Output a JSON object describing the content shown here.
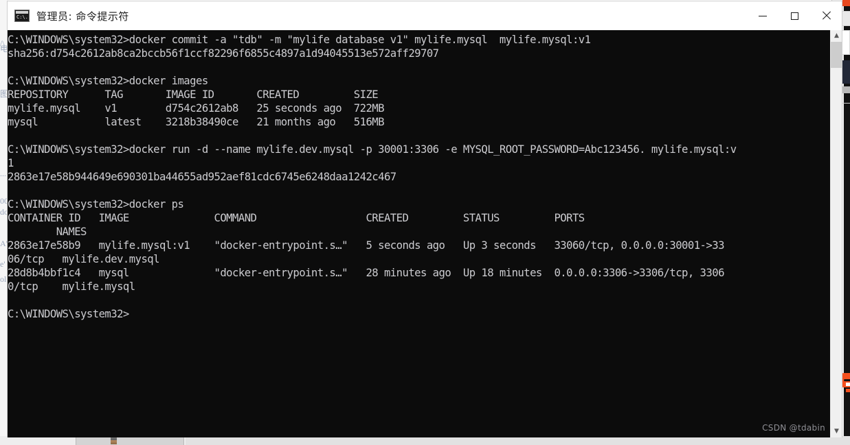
{
  "window": {
    "title": "管理员: 命令提示符",
    "icon": "cmd-icon",
    "icon_text": "C:\\.",
    "controls": {
      "minimize": "minimize-button",
      "maximize": "maximize-button",
      "close": "close-button"
    }
  },
  "console": {
    "prompt": "C:\\WINDOWS\\system32>",
    "lines": [
      "C:\\WINDOWS\\system32>docker commit -a \"tdb\" -m \"mylife database v1\" mylife.mysql  mylife.mysql:v1",
      "sha256:d754c2612ab8ca2bccb56f1ccf82296f6855c4897a1d94045513e572aff29707",
      "",
      "C:\\WINDOWS\\system32>docker images",
      "REPOSITORY      TAG       IMAGE ID       CREATED         SIZE",
      "mylife.mysql    v1        d754c2612ab8   25 seconds ago  722MB",
      "mysql           latest    3218b38490ce   21 months ago   516MB",
      "",
      "C:\\WINDOWS\\system32>docker run -d --name mylife.dev.mysql -p 30001:3306 -e MYSQL_ROOT_PASSWORD=Abc123456. mylife.mysql:v",
      "1",
      "2863e17e58b944649e690301ba44655ad952aef81cdc6745e6248daa1242c467",
      "",
      "C:\\WINDOWS\\system32>docker ps",
      "CONTAINER ID   IMAGE              COMMAND                  CREATED         STATUS         PORTS",
      "        NAMES",
      "2863e17e58b9   mylife.mysql:v1    \"docker-entrypoint.s…\"   5 seconds ago   Up 3 seconds   33060/tcp, 0.0.0.0:30001->33",
      "06/tcp   mylife.dev.mysql",
      "28d8b4bbf1c4   mysql              \"docker-entrypoint.s…\"   28 minutes ago  Up 18 minutes  0.0.0.0:3306->3306/tcp, 3306",
      "0/tcp    mylife.mysql",
      "",
      "C:\\WINDOWS\\system32>"
    ],
    "scrollbar": {
      "up_arrow": "▲",
      "down_arrow": "▼"
    }
  },
  "watermark": {
    "text": "CSDN @tdabin"
  },
  "background": {
    "left_glyphs": [
      "/\\",
      "电",
      "图",
      "(6",
      "...",
      "00",
      "do",
      "A'",
      "e'",
      "ol"
    ],
    "right_letter": "E",
    "right_letter2": "P"
  },
  "chart_data": null
}
